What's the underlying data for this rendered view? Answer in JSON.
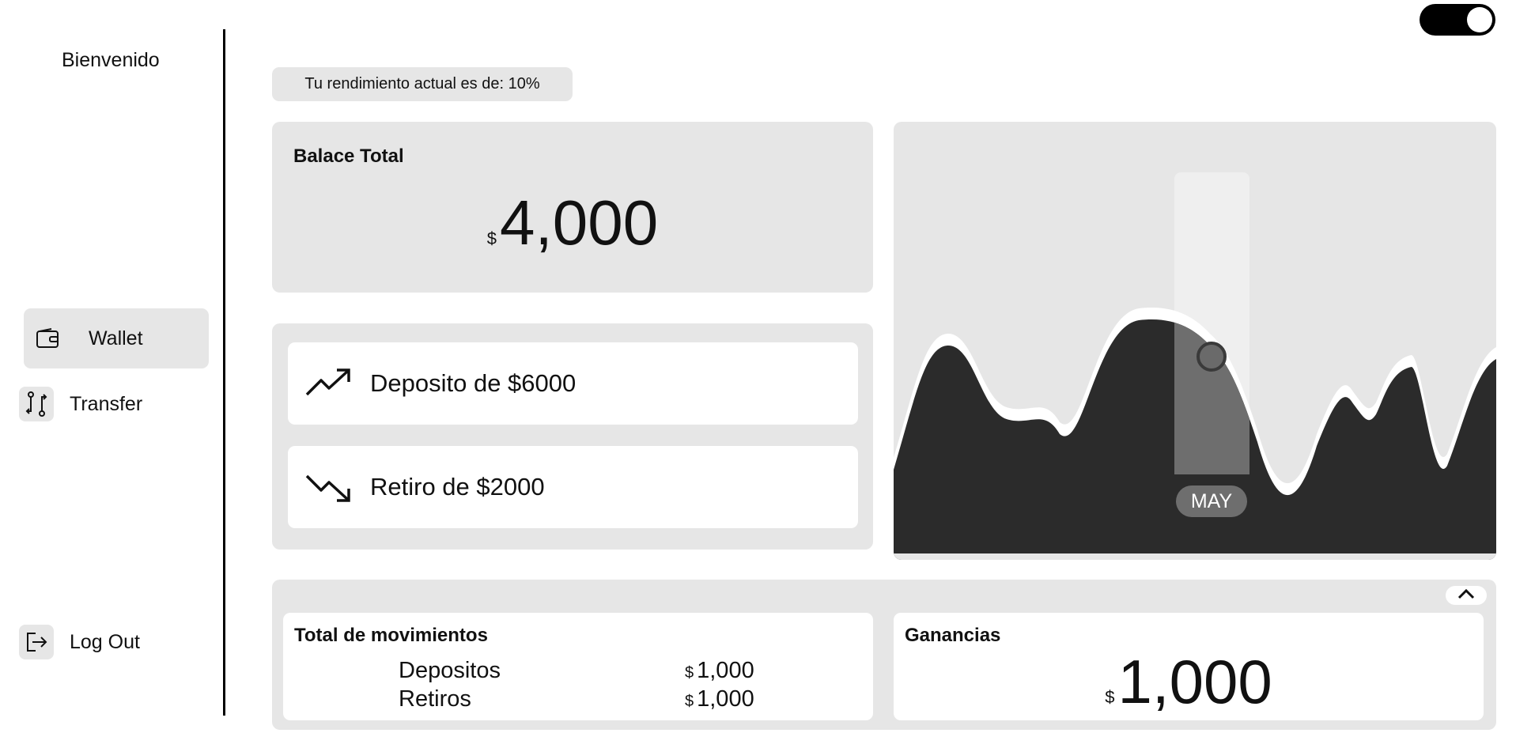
{
  "sidebar": {
    "welcome": "Bienvenido",
    "items": [
      {
        "label": "Wallet",
        "icon": "wallet-icon",
        "active": true
      },
      {
        "label": "Transfer",
        "icon": "transfer-icon",
        "active": false
      }
    ],
    "logout": {
      "label": "Log Out",
      "icon": "logout-icon"
    }
  },
  "header": {
    "theme_toggle": {
      "state": "on"
    },
    "performance": "Tu rendimiento actual es de: 10%"
  },
  "balance": {
    "title": "Balace Total",
    "currency": "$",
    "amount": "4,000"
  },
  "movements": [
    {
      "text": "Deposito de $6000",
      "icon": "trending-up-icon"
    },
    {
      "text": "Retiro de $2000",
      "icon": "trending-down-icon"
    }
  ],
  "chart": {
    "highlight_label": "MAY",
    "colors": {
      "fill": "#2b2b2b",
      "highlight": "#6e6e6e",
      "band": "#efefef",
      "background": "#e6e6e6"
    }
  },
  "summary": {
    "totals": {
      "title": "Total de movimientos",
      "rows": [
        {
          "label": "Depositos",
          "currency": "$",
          "value": "1,000"
        },
        {
          "label": "Retiros",
          "currency": "$",
          "value": "1,000"
        }
      ]
    },
    "gains": {
      "title": "Ganancias",
      "currency": "$",
      "amount": "1,000"
    }
  }
}
